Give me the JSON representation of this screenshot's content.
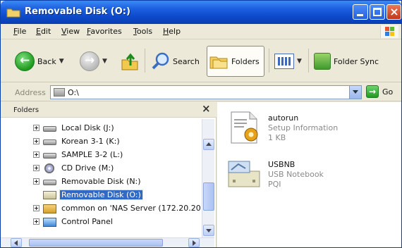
{
  "window": {
    "title": "Removable Disk (O:)",
    "close_glyph": "×"
  },
  "menu": {
    "items": [
      "File",
      "Edit",
      "View",
      "Favorites",
      "Tools",
      "Help"
    ]
  },
  "toolbar": {
    "back_label": "Back",
    "search_label": "Search",
    "folders_label": "Folders",
    "folder_sync_label": "Folder Sync"
  },
  "address": {
    "label": "Address",
    "value": "O:\\",
    "go_label": "Go"
  },
  "folder_pane": {
    "title": "Folders",
    "close_glyph": "×",
    "items": [
      {
        "label": "Local Disk (J:)",
        "icon": "drive-icon"
      },
      {
        "label": "Korean 3-1 (K:)",
        "icon": "drive-icon"
      },
      {
        "label": "SAMPLE 3-2 (L:)",
        "icon": "drive-icon"
      },
      {
        "label": "CD Drive (M:)",
        "icon": "cd-drive-icon"
      },
      {
        "label": "Removable Disk (N:)",
        "icon": "drive-icon"
      },
      {
        "label": "Removable Disk (O:)",
        "icon": "removable-disk-icon",
        "selected": true
      },
      {
        "label": "common on 'NAS Server (172.20.20.",
        "icon": "network-share-icon"
      },
      {
        "label": "Control Panel",
        "icon": "control-panel-icon"
      }
    ]
  },
  "files": [
    {
      "name": "autorun",
      "type": "Setup Information",
      "size": "1 KB",
      "icon": "setup-info-file-icon"
    },
    {
      "name": "USBNB",
      "type": "USB Notebook",
      "size": "PQI",
      "icon": "usb-notebook-icon"
    }
  ],
  "colors": {
    "titlebar": "#0c49c9",
    "selection": "#316ac5",
    "chrome": "#ece9d8"
  }
}
